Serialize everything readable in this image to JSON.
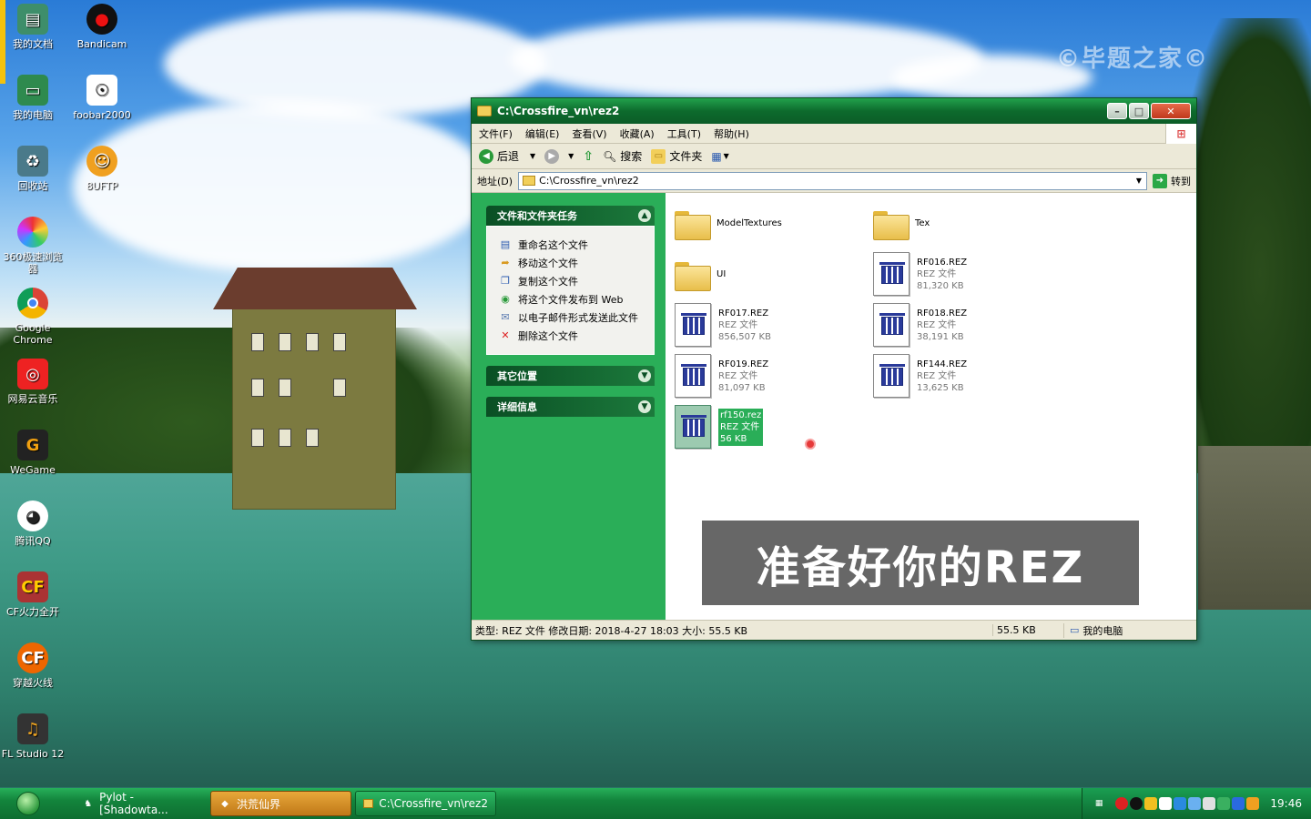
{
  "desktop": {
    "watermark": "©毕题之家©",
    "icons": [
      {
        "label": "我的文档",
        "icon": "my-documents-icon",
        "color": "#3e8e6a"
      },
      {
        "label": "Bandicam",
        "icon": "bandicam-icon",
        "color": "#d11"
      },
      {
        "label": "我的电脑",
        "icon": "my-computer-icon",
        "color": "#2e8a4e"
      },
      {
        "label": "foobar2000",
        "icon": "foobar-icon",
        "color": "#ffffff"
      },
      {
        "label": "回收站",
        "icon": "recycle-bin-icon",
        "color": "#4a7a8a"
      },
      {
        "label": "8UFTP",
        "icon": "ftp-icon",
        "color": "#f0a020"
      },
      {
        "label": "360极速浏览器",
        "icon": "360-browser-icon",
        "color": "#e84"
      },
      {
        "label": "Google Chrome",
        "icon": "chrome-icon",
        "color": "#db4437"
      },
      {
        "label": "网易云音乐",
        "icon": "netease-music-icon",
        "color": "#e22"
      },
      {
        "label": "WeGame",
        "icon": "wegame-icon",
        "color": "#f0a010"
      },
      {
        "label": "腾讯QQ",
        "icon": "qq-icon",
        "color": "#222"
      },
      {
        "label": "CF火力全开",
        "icon": "cf-icon",
        "color": "#a33"
      },
      {
        "label": "穿越火线",
        "icon": "crossfire-icon",
        "color": "#e60"
      },
      {
        "label": "FL Studio 12",
        "icon": "fl-studio-icon",
        "color": "#e8a020"
      }
    ]
  },
  "window": {
    "title": "C:\\Crossfire_vn\\rez2",
    "controls": {
      "minimize": "–",
      "maximize": "□",
      "close": "✕"
    },
    "menu": [
      "文件(F)",
      "编辑(E)",
      "查看(V)",
      "收藏(A)",
      "工具(T)",
      "帮助(H)"
    ],
    "toolbar": {
      "back": "后退",
      "search": "搜索",
      "folders": "文件夹"
    },
    "address": {
      "label": "地址(D)",
      "value": "C:\\Crossfire_vn\\rez2",
      "go": "转到"
    },
    "tasks_panel": {
      "title": "文件和文件夹任务",
      "items": [
        {
          "label": "重命名这个文件",
          "icon": "rename-icon"
        },
        {
          "label": "移动这个文件",
          "icon": "move-icon"
        },
        {
          "label": "复制这个文件",
          "icon": "copy-icon"
        },
        {
          "label": "将这个文件发布到 Web",
          "icon": "publish-web-icon"
        },
        {
          "label": "以电子邮件形式发送此文件",
          "icon": "email-icon"
        },
        {
          "label": "删除这个文件",
          "icon": "delete-icon"
        }
      ]
    },
    "other_places": {
      "title": "其它位置"
    },
    "details": {
      "title": "详细信息"
    },
    "files": [
      {
        "name": "ModelTextures",
        "type": "",
        "size": "",
        "kind": "folder"
      },
      {
        "name": "Tex",
        "type": "",
        "size": "",
        "kind": "folder"
      },
      {
        "name": "UI",
        "type": "",
        "size": "",
        "kind": "folder"
      },
      {
        "name": "RF016.REZ",
        "type": "REZ 文件",
        "size": "81,320 KB",
        "kind": "file"
      },
      {
        "name": "RF017.REZ",
        "type": "REZ 文件",
        "size": "856,507 KB",
        "kind": "file"
      },
      {
        "name": "RF018.REZ",
        "type": "REZ 文件",
        "size": "38,191 KB",
        "kind": "file"
      },
      {
        "name": "RF019.REZ",
        "type": "REZ 文件",
        "size": "81,097 KB",
        "kind": "file"
      },
      {
        "name": "RF144.REZ",
        "type": "REZ 文件",
        "size": "13,625 KB",
        "kind": "file"
      },
      {
        "name": "rf150.rez",
        "type": "REZ 文件",
        "size": "56 KB",
        "kind": "file",
        "selected": true
      }
    ],
    "banner": "准备好你的REZ",
    "status": {
      "info": "类型: REZ 文件 修改日期: 2018-4-27 18:03 大小: 55.5 KB",
      "size": "55.5 KB",
      "location": "我的电脑"
    }
  },
  "taskbar": {
    "buttons": [
      {
        "label": "Pylot - [Shadowta...",
        "active": false
      },
      {
        "label": "洪荒仙界",
        "active": true
      },
      {
        "label": "C:\\Crossfire_vn\\rez2",
        "active": false
      }
    ],
    "clock": "19:46"
  }
}
